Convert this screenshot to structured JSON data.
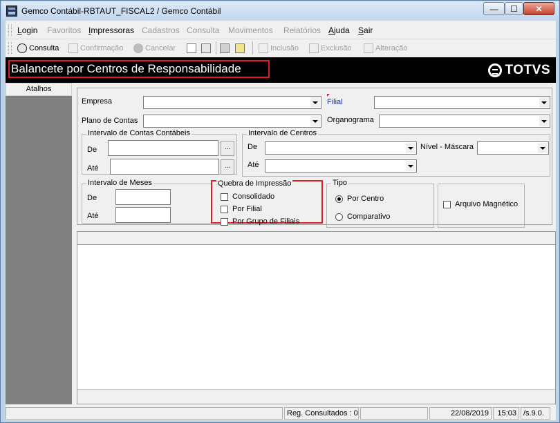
{
  "window": {
    "title": "Gemco Contábil-RBTAUT_FISCAL2 / Gemco Contábil",
    "min_glyph": "—",
    "max_glyph": "☐",
    "close_glyph": "✕"
  },
  "menu": {
    "items": [
      {
        "label": "Login",
        "enabled": true
      },
      {
        "label": "Favoritos",
        "enabled": false
      },
      {
        "label": "Impressoras",
        "enabled": true
      },
      {
        "label": "Cadastros",
        "enabled": false
      },
      {
        "label": "Consulta",
        "enabled": false
      },
      {
        "label": "Movimentos",
        "enabled": false
      },
      {
        "label": "Relatórios",
        "enabled": false
      },
      {
        "label": "Ajuda",
        "enabled": true
      },
      {
        "label": "Sair",
        "enabled": true
      }
    ]
  },
  "toolbar": {
    "consulta": "Consulta",
    "confirmacao": "Confirmação",
    "cancelar": "Cancelar",
    "inclusao": "Inclusão",
    "exclusao": "Exclusão",
    "alteracao": "Alteração"
  },
  "header": {
    "title": "Balancete por Centros de Responsabilidade",
    "logo_text": "TOTVS"
  },
  "sidebar": {
    "atalhos": "Atalhos"
  },
  "form": {
    "empresa_label": "Empresa",
    "empresa_value": "",
    "filial_label": "Filial",
    "filial_value": "",
    "plano_label": "Plano de Contas",
    "plano_value": "",
    "organograma_label": "Organograma",
    "organograma_value": "",
    "contas": {
      "title": "Intervalo de Contas Contábeis",
      "de_label": "De",
      "ate_label": "Até",
      "lookup": "..."
    },
    "centros": {
      "title": "Intervalo de Centros",
      "de_label": "De",
      "ate_label": "Até",
      "nivel_label": "Nível - Máscara"
    },
    "meses": {
      "title": "Intervalo de Meses",
      "de_label": "De",
      "ate_label": "Até"
    },
    "quebra": {
      "title": "Quebra de Impressão",
      "options": [
        {
          "label": "Consolidado",
          "checked": false
        },
        {
          "label": "Por Filial",
          "checked": false
        },
        {
          "label": "Por Grupo de Filiais",
          "checked": false
        }
      ]
    },
    "tipo": {
      "title": "Tipo",
      "options": [
        {
          "label": "Por Centro",
          "selected": true
        },
        {
          "label": "Comparativo",
          "selected": false
        }
      ]
    },
    "arquivo": {
      "label": "Arquivo Magnético",
      "checked": false
    }
  },
  "status": {
    "reg_consultados": "Reg. Consultados : 0",
    "date": "22/08/2019",
    "time": "15:03",
    "version": "/s.9.0."
  },
  "colors": {
    "highlight": "#e01d24",
    "header_bg": "#000000",
    "sidebar_bg": "#808080"
  }
}
